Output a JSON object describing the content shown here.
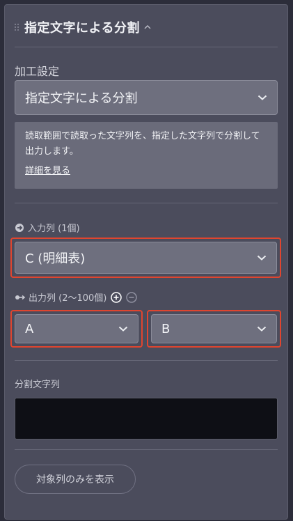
{
  "header": {
    "title": "指定文字による分割"
  },
  "processing": {
    "label": "加工設定",
    "selected": "指定文字による分割",
    "description": "読取範囲で読取った文字列を、指定した文字列で分割して出力します。",
    "link_text": "詳細を見る"
  },
  "input_column": {
    "label": "入力列 (1個)",
    "selected": "C (明細表)"
  },
  "output_columns": {
    "label": "出力列 (2〜100個)",
    "items": [
      {
        "selected": "A"
      },
      {
        "selected": "B"
      }
    ]
  },
  "split_string": {
    "label": "分割文字列",
    "value": ""
  },
  "show_target_button": "対象列のみを表示",
  "colors": {
    "panel_bg": "#4b4c5c",
    "select_bg": "#6e6f7e",
    "highlight": "#e0452f",
    "input_bg": "#0e0f15"
  }
}
